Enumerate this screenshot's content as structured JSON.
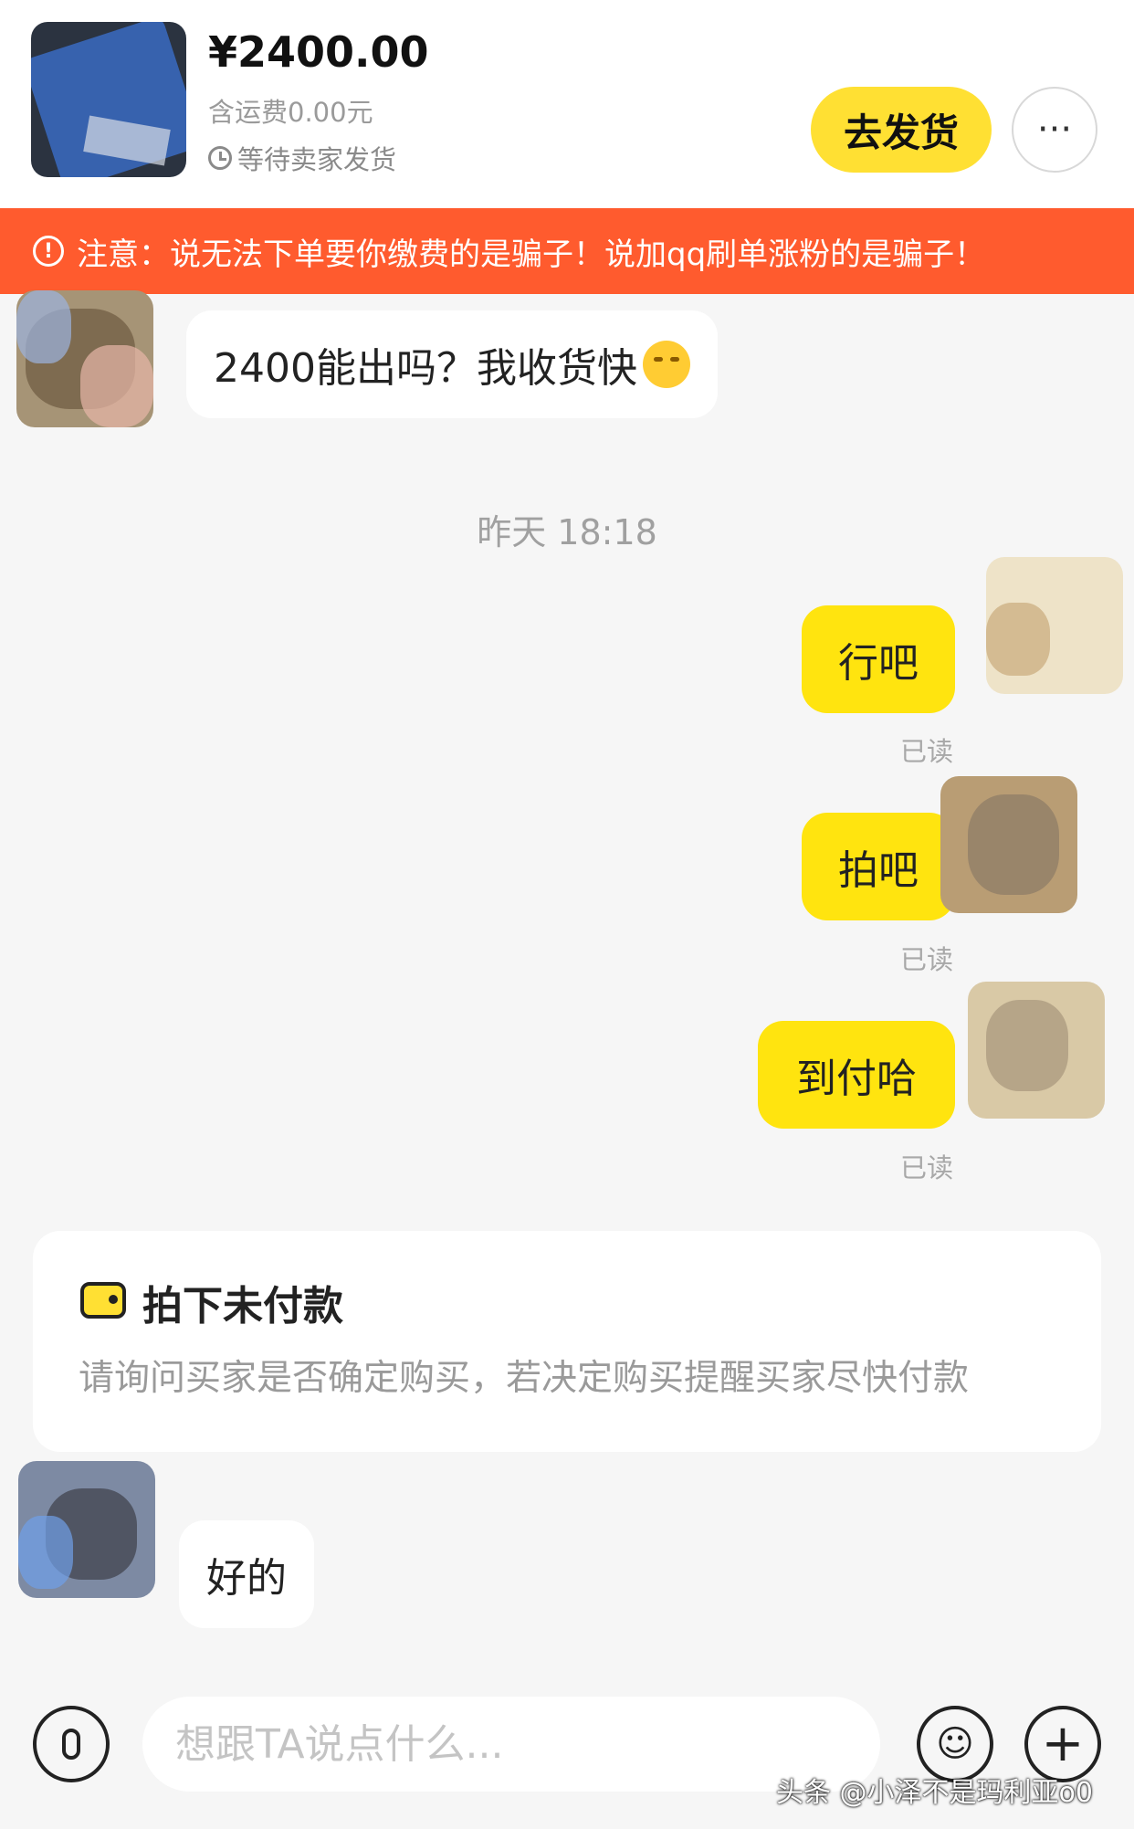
{
  "header": {
    "price": "¥2400.00",
    "shipping_note": "含运费0.00元",
    "status": "等待卖家发货",
    "ship_button_label": "去发货",
    "more_button_label": "···"
  },
  "warning": {
    "text": "注意：说无法下单要你缴费的是骗子！说加qq刷单涨粉的是骗子！"
  },
  "messages": {
    "m1_text": "2400能出吗？我收货快",
    "timestamp": "昨天 18:18",
    "m2_text": "行吧",
    "m2_status": "已读",
    "m3_text": "拍吧",
    "m3_status": "已读",
    "m4_text": "到付哈",
    "m4_status": "已读",
    "m5_text": "好的"
  },
  "card": {
    "title": "拍下未付款",
    "description": "请询问买家是否确定购买，若决定购买提醒买家尽快付款"
  },
  "input_bar": {
    "placeholder": "想跟TA说点什么..."
  },
  "watermark": "头条 @小泽不是玛利亚o0",
  "colors": {
    "accent_yellow": "#ffe40f",
    "warning_orange": "#ff5b2e",
    "background": "#f6f6f6"
  },
  "icons": [
    "clock-icon",
    "more-icon",
    "warning-icon",
    "emoji-icon",
    "wallet-icon",
    "microphone-icon",
    "smiley-icon",
    "plus-icon"
  ]
}
